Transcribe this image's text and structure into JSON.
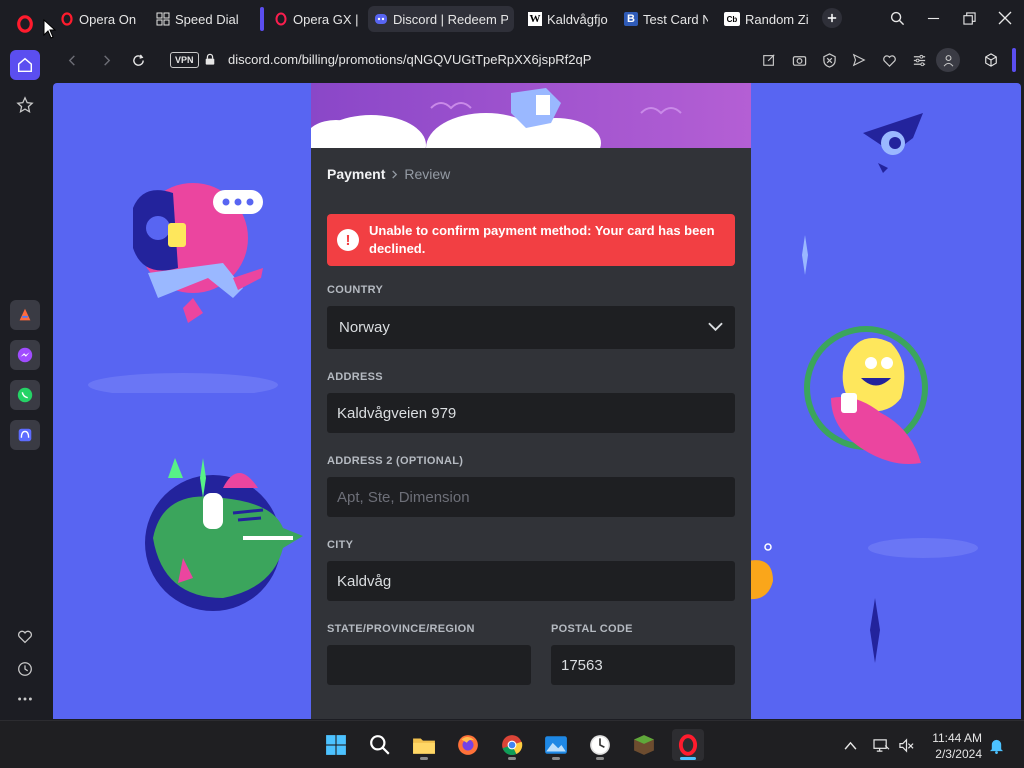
{
  "browser": {
    "tabs": [
      {
        "label": "Opera One",
        "icon": "opera-icon",
        "active": false
      },
      {
        "label": "Speed Dial",
        "icon": "speed-dial-icon",
        "active": false
      },
      {
        "label": "Opera GX | G",
        "icon": "opera-gx-icon",
        "active": false
      },
      {
        "label": "Discord | Redeem Pro",
        "icon": "discord-icon",
        "active": true
      },
      {
        "label": "Kaldvågfjord",
        "icon": "wikipedia-icon",
        "active": false
      },
      {
        "label": "Test Card Nu",
        "icon": "bookmark-b-icon",
        "active": false
      },
      {
        "label": "Random Zip",
        "icon": "cb-icon",
        "active": false
      }
    ],
    "vpn_label": "VPN",
    "url": "discord.com/billing/promotions/qNGQVUGtTpeRpXX6jspRf2qP"
  },
  "form": {
    "breadcrumb_active": "Payment",
    "breadcrumb_next": "Review",
    "error_message": "Unable to confirm payment method: Your card has been declined.",
    "country_label": "COUNTRY",
    "country_value": "Norway",
    "address_label": "ADDRESS",
    "address_value": "Kaldvågveien 979",
    "address2_label": "ADDRESS 2 (OPTIONAL)",
    "address2_placeholder": "Apt, Ste, Dimension",
    "city_label": "CITY",
    "city_value": "Kaldvåg",
    "state_label": "STATE/PROVINCE/REGION",
    "state_value": "",
    "postal_label": "POSTAL CODE",
    "postal_value": "17563"
  },
  "taskbar": {
    "time": "11:44 AM",
    "date": "2/3/2024"
  },
  "colors": {
    "discord_blurple": "#5865f2",
    "error_red": "#f23f43",
    "modal_bg": "#313338",
    "input_bg": "#1e1f22",
    "opera_red": "#ff1b2d"
  }
}
